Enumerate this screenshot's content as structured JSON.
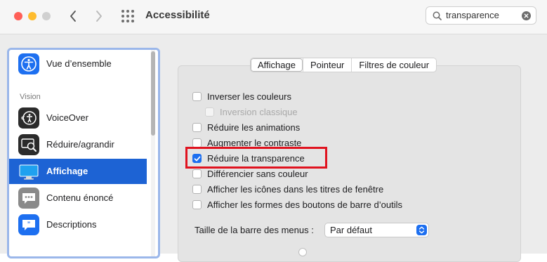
{
  "window": {
    "title": "Accessibilité",
    "traffic_lights": {
      "close": "#ff5f57",
      "minimize": "#febc2e",
      "zoom": "#d0d0d0"
    }
  },
  "search": {
    "value": "transparence",
    "icon": "search-icon",
    "clear_icon": "clear-icon"
  },
  "sidebar": {
    "items": [
      {
        "label": "Vue d’ensemble",
        "icon": "accessibility-icon",
        "color": "#1d6ff0"
      },
      {
        "label": "VoiceOver",
        "icon": "voiceover-icon",
        "color": "#2b2b2b"
      },
      {
        "label": "Réduire/agrandir",
        "icon": "zoom-icon",
        "color": "#2b2b2b"
      },
      {
        "label": "Affichage",
        "icon": "display-icon",
        "color": "#1fa1ef",
        "selected": true
      },
      {
        "label": "Contenu énoncé",
        "icon": "spoken-content-icon",
        "color": "#8a8a8a"
      },
      {
        "label": "Descriptions",
        "icon": "descriptions-icon",
        "color": "#1d6ff0"
      }
    ],
    "section_vision": "Vision"
  },
  "tabs": [
    {
      "label": "Affichage",
      "active": true
    },
    {
      "label": "Pointeur"
    },
    {
      "label": "Filtres de couleur"
    }
  ],
  "options": [
    {
      "label": "Inverser les couleurs",
      "checked": false
    },
    {
      "label": "Inversion classique",
      "checked": false,
      "disabled": true
    },
    {
      "label": "Réduire les animations",
      "checked": false
    },
    {
      "label": "Augmenter le contraste",
      "checked": false
    },
    {
      "label": "Réduire la transparence",
      "checked": true
    },
    {
      "label": "Différencier sans couleur",
      "checked": false
    },
    {
      "label": "Afficher les icônes dans les titres de fenêtre",
      "checked": false
    },
    {
      "label": "Afficher les formes des boutons de barre d’outils",
      "checked": false
    }
  ],
  "menubar_size": {
    "label": "Taille de la barre des menus :",
    "value": "Par défaut"
  },
  "colors": {
    "accent": "#1d6ff0",
    "selection": "#1d63d4",
    "highlight_box": "#e0131f"
  }
}
